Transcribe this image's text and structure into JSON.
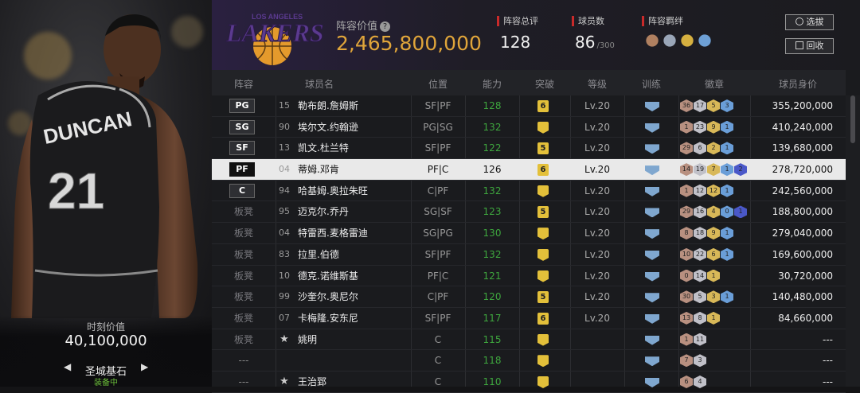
{
  "card": {
    "market_label": "时刻价值",
    "market_value": "40,100,000",
    "card_name": "圣城基石",
    "status": "装备中",
    "jersey_name": "DUNCAN",
    "jersey_number": "21"
  },
  "header": {
    "team_logo_text": "LAKERS",
    "team_logo_small": "LOS ANGELES",
    "lineup_value_label": "阵容价值",
    "lineup_value": "2,465,800,000",
    "rating_label": "阵容总评",
    "rating": "128",
    "count_label": "球员数",
    "count": "86",
    "count_max": "/300",
    "chem_label": "阵容羁绊",
    "filter_button": "选拔",
    "recycle_button": "回收"
  },
  "columns": [
    "阵容",
    "球员名",
    "位置",
    "能力",
    "突破",
    "等级",
    "训练",
    "徽章",
    "球员身价"
  ],
  "rows": [
    {
      "slot": "PG",
      "num": "15",
      "name": "勒布朗.詹姆斯",
      "pos": "SF|PF",
      "ovr": "128",
      "brk": "6",
      "lvl": "Lv.20",
      "badges": [
        "36",
        "17",
        "5",
        "3"
      ],
      "price": "355,200,000"
    },
    {
      "slot": "SG",
      "num": "90",
      "name": "埃尔文.约翰逊",
      "pos": "PG|SG",
      "ovr": "132",
      "brk": "",
      "lvl": "Lv.20",
      "badges": [
        "1",
        "23",
        "9",
        "1"
      ],
      "price": "410,240,000"
    },
    {
      "slot": "SF",
      "num": "13",
      "name": "凯文.杜兰特",
      "pos": "SF|PF",
      "ovr": "122",
      "brk": "5",
      "lvl": "Lv.20",
      "badges": [
        "29",
        "6",
        "2",
        "1"
      ],
      "price": "139,680,000"
    },
    {
      "slot": "PF",
      "num": "04",
      "name": "蒂姆.邓肯",
      "pos": "PF|C",
      "ovr": "126",
      "brk": "6",
      "lvl": "Lv.20",
      "badges": [
        "14",
        "19",
        "7",
        "1",
        "2"
      ],
      "price": "278,720,000",
      "selected": true
    },
    {
      "slot": "C",
      "num": "94",
      "name": "哈基姆.奥拉朱旺",
      "pos": "C|PF",
      "ovr": "132",
      "brk": "",
      "lvl": "Lv.20",
      "badges": [
        "1",
        "12",
        "12",
        "1"
      ],
      "price": "242,560,000"
    },
    {
      "slot": "板凳",
      "num": "95",
      "name": "迈克尔.乔丹",
      "pos": "SG|SF",
      "ovr": "123",
      "brk": "5",
      "lvl": "Lv.20",
      "badges": [
        "29",
        "16",
        "4",
        "0",
        "1"
      ],
      "price": "188,800,000"
    },
    {
      "slot": "板凳",
      "num": "04",
      "name": "特雷西.麦格雷迪",
      "pos": "SG|PG",
      "ovr": "130",
      "brk": "",
      "lvl": "Lv.20",
      "badges": [
        "8",
        "18",
        "9",
        "1"
      ],
      "price": "279,040,000"
    },
    {
      "slot": "板凳",
      "num": "83",
      "name": "拉里.伯德",
      "pos": "SF|PF",
      "ovr": "132",
      "brk": "",
      "lvl": "Lv.20",
      "badges": [
        "10",
        "22",
        "6",
        "1"
      ],
      "price": "169,600,000"
    },
    {
      "slot": "板凳",
      "num": "10",
      "name": "德克.诺维斯基",
      "pos": "PF|C",
      "ovr": "121",
      "brk": "",
      "lvl": "Lv.20",
      "badges": [
        "0",
        "14",
        "1"
      ],
      "price": "30,720,000"
    },
    {
      "slot": "板凳",
      "num": "99",
      "name": "沙奎尔.奥尼尔",
      "pos": "C|PF",
      "ovr": "120",
      "brk": "5",
      "lvl": "Lv.20",
      "badges": [
        "30",
        "5",
        "3",
        "1"
      ],
      "price": "140,480,000"
    },
    {
      "slot": "板凳",
      "num": "07",
      "name": "卡梅隆.安东尼",
      "pos": "SF|PF",
      "ovr": "117",
      "brk": "6",
      "lvl": "Lv.20",
      "badges": [
        "13",
        "8",
        "1"
      ],
      "price": "84,660,000"
    },
    {
      "slot": "板凳",
      "num": "★",
      "name": "姚明",
      "pos": "C",
      "ovr": "115",
      "brk": "",
      "lvl": "",
      "badges": [
        "1",
        "11"
      ],
      "price": "---"
    },
    {
      "slot": "---",
      "num": "",
      "name": "",
      "pos": "C",
      "ovr": "118",
      "brk": "",
      "lvl": "",
      "badges": [
        "7",
        "3"
      ],
      "price": "---"
    },
    {
      "slot": "---",
      "num": "★",
      "name": "王治郅",
      "pos": "C",
      "ovr": "110",
      "brk": "",
      "lvl": "",
      "badges": [
        "6",
        "4"
      ],
      "price": "---"
    }
  ]
}
